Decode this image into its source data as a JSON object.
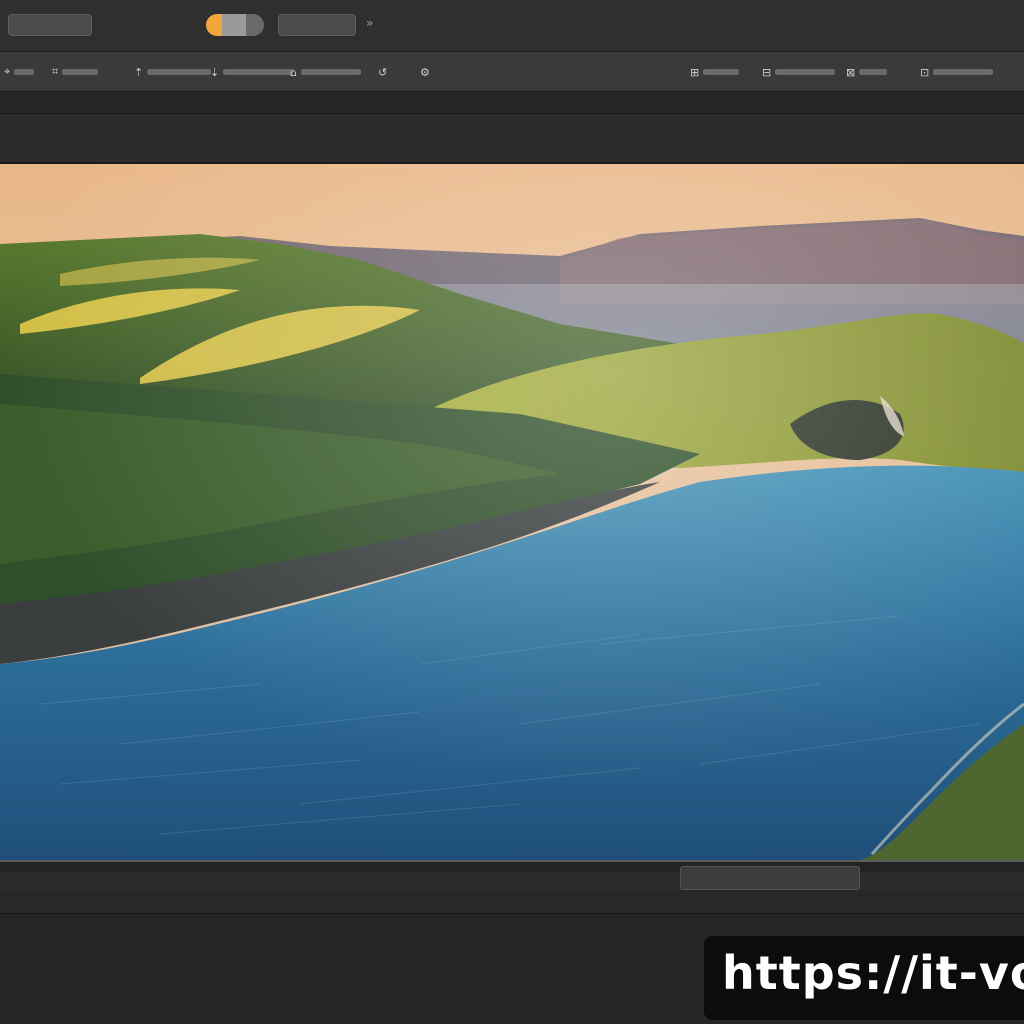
{
  "title_bar": {
    "app_name": "",
    "chevron": "»"
  },
  "toolbar": {
    "tools": [
      {
        "name": "tool-1",
        "glyph": "⌖"
      },
      {
        "name": "tool-2",
        "glyph": "⌗"
      },
      {
        "name": "tool-3",
        "glyph": "⇡"
      },
      {
        "name": "tool-4",
        "glyph": "⇣"
      },
      {
        "name": "tool-5",
        "glyph": "⌂"
      },
      {
        "name": "tool-6",
        "glyph": "↺"
      },
      {
        "name": "tool-7",
        "glyph": "⚙"
      }
    ],
    "right_tools": [
      {
        "name": "right-tool-1",
        "glyph": "⊞"
      },
      {
        "name": "right-tool-2",
        "glyph": "⊟"
      },
      {
        "name": "right-tool-3",
        "glyph": "⊠"
      },
      {
        "name": "right-tool-4",
        "glyph": "⊡"
      }
    ]
  },
  "panel": {
    "label": ""
  },
  "timeline": {
    "active_label": "",
    "tracks": [
      "",
      "",
      "",
      "",
      "",
      "",
      "",
      "",
      "",
      ""
    ]
  },
  "watermark": {
    "text": "https://it-vo"
  },
  "colors": {
    "accent": "#f0a63a",
    "water": "#2f6f9a",
    "sky": "#e8b68a"
  }
}
